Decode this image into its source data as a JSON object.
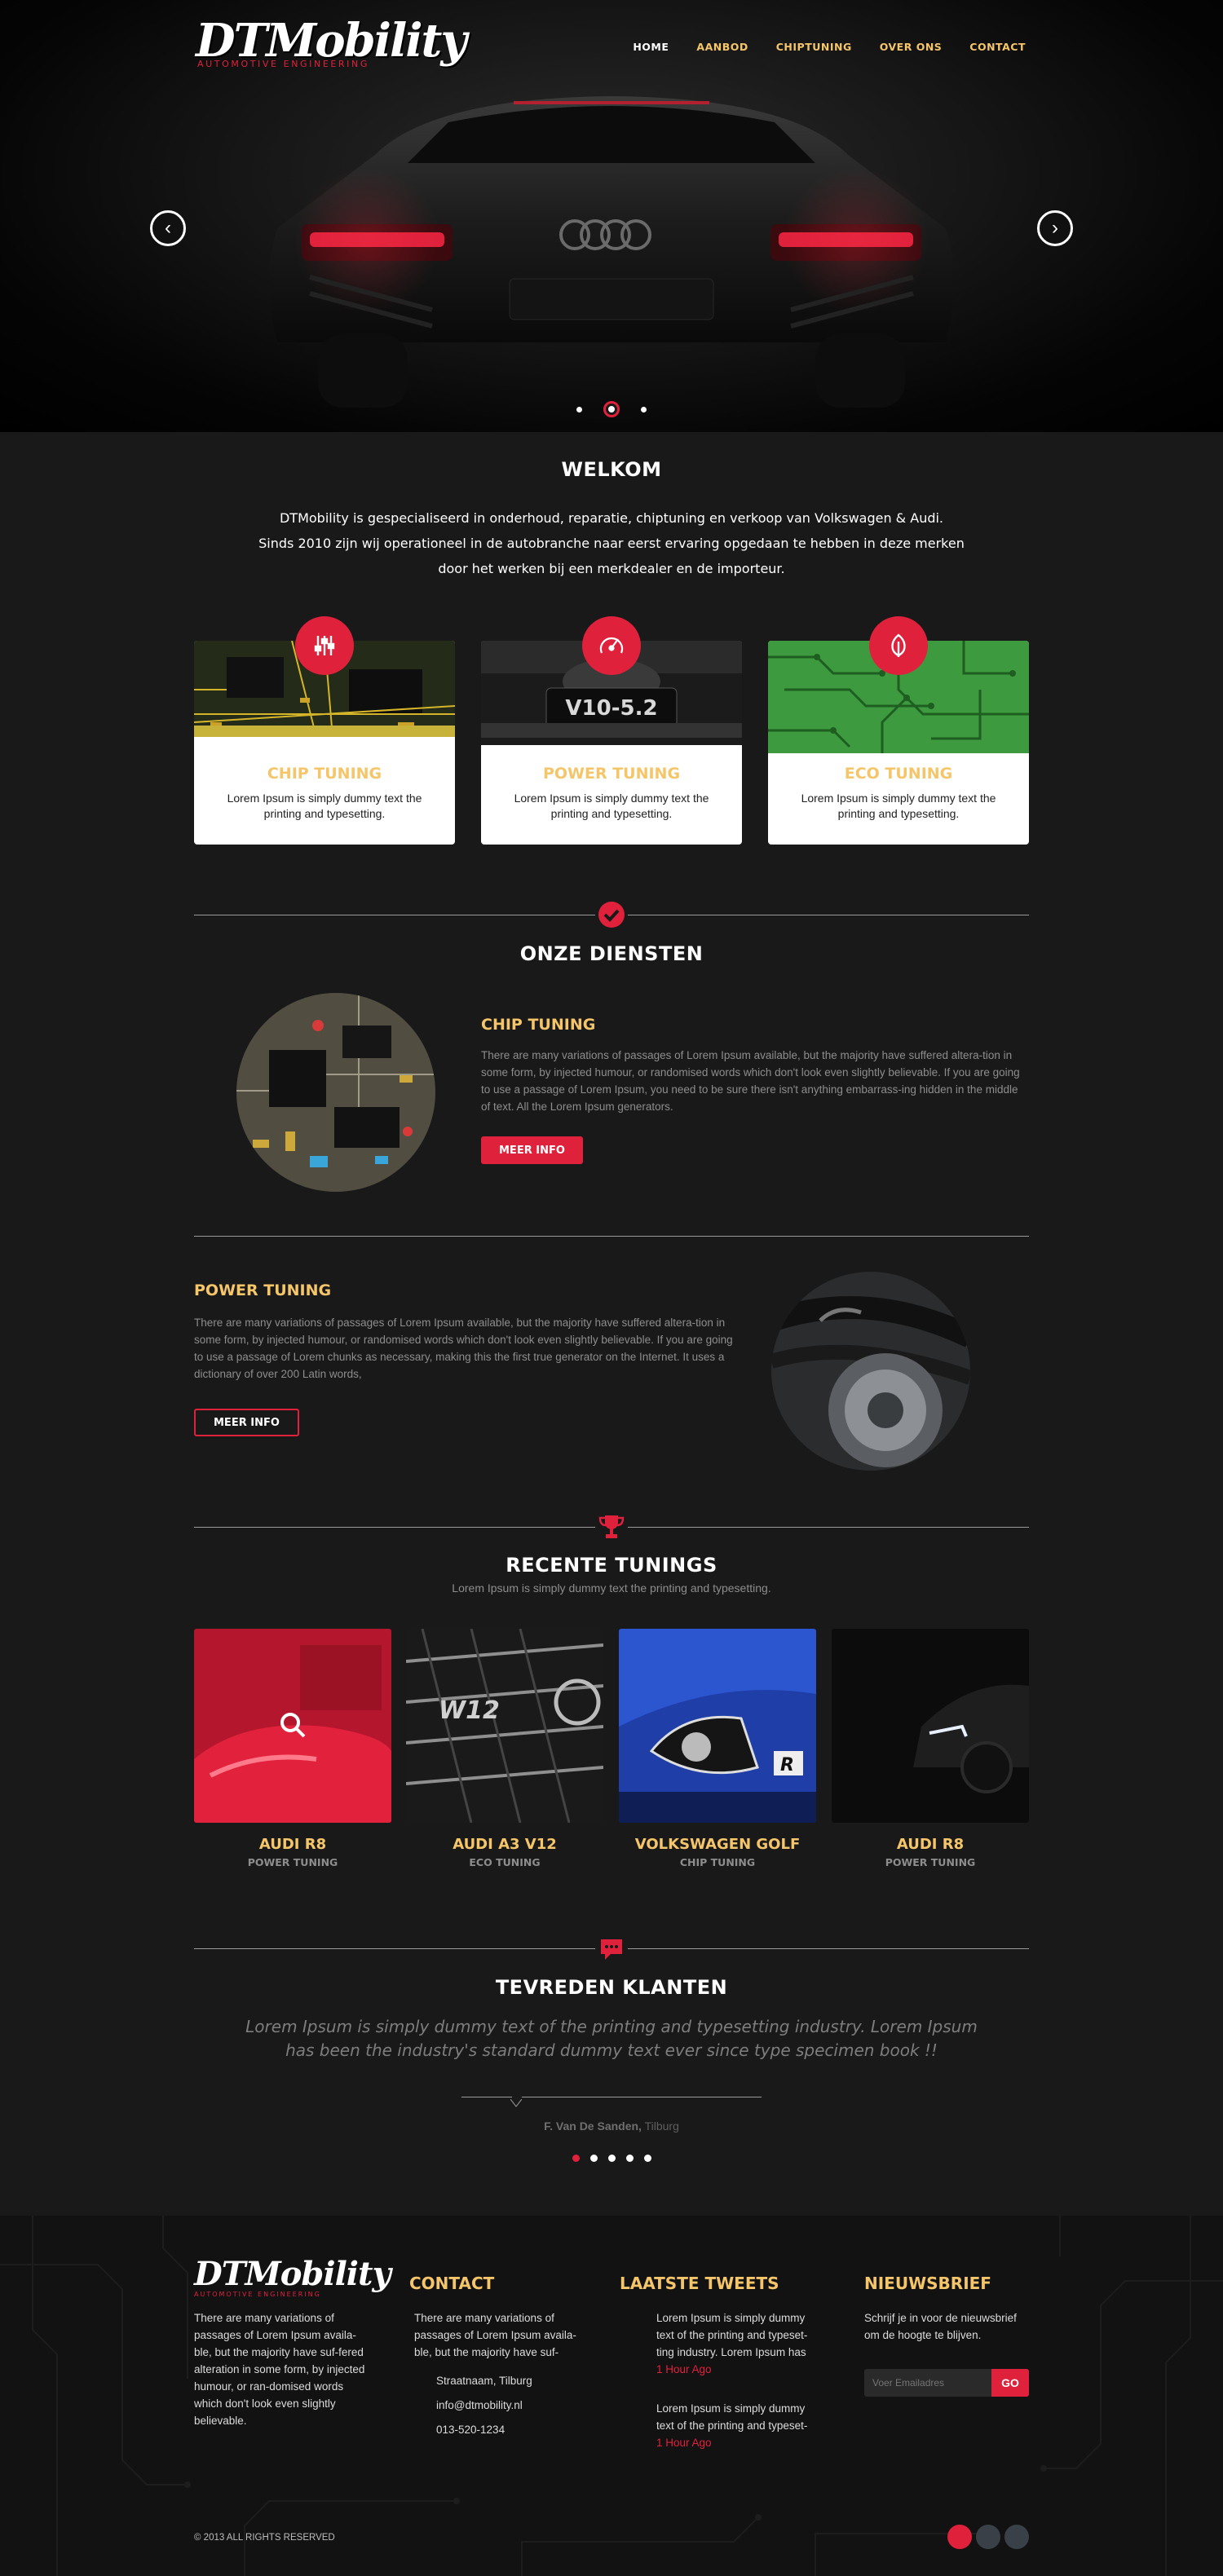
{
  "brand": {
    "name": "DTMobility",
    "tagline": "Automotive Engineering"
  },
  "nav": {
    "items": [
      "HOME",
      "AANBOD",
      "CHIPTUNING",
      "OVER ONS",
      "CONTACT"
    ],
    "active": "HOME"
  },
  "hero": {
    "prev_glyph": "‹",
    "next_glyph": "›",
    "slide_count": 3,
    "active_slide": 2
  },
  "welcome": {
    "title": "WELKOM",
    "lines": [
      "DTMobility is gespecialiseerd in onderhoud, reparatie, chiptuning en verkoop van Volkswagen & Audi.",
      "Sinds 2010 zijn wij operationeel in de autobranche naar eerst ervaring opgedaan te hebben in deze merken",
      "door het werken bij een merkdealer en de importeur."
    ]
  },
  "features": [
    {
      "title": "CHIP TUNING",
      "text": "Lorem Ipsum is simply dummy text the printing and typesetting.",
      "icon": "equalizer-icon"
    },
    {
      "title": "POWER TUNING",
      "text": "Lorem Ipsum is simply dummy text the printing and typesetting.",
      "icon": "speedometer-icon"
    },
    {
      "title": "ECO TUNING",
      "text": "Lorem Ipsum is simply dummy text the printing and typesetting.",
      "icon": "leaf-icon"
    }
  ],
  "services": {
    "title": "ONZE DIENSTEN",
    "icon": "check-circle-icon",
    "items": [
      {
        "title": "CHIP TUNING",
        "text": "There are many variations of passages of Lorem Ipsum available, but the majority have suffered altera-tion in some form, by injected humour, or randomised words which don't look even slightly believable. If you are going to use a passage of Lorem Ipsum, you need to be sure there isn't anything embarrass-ing hidden in the middle of text. All the Lorem Ipsum generators.",
        "button": "MEER INFO"
      },
      {
        "title": "POWER TUNING",
        "text": "There are many variations of passages of Lorem Ipsum available, but the majority have suffered altera-tion in some form, by injected humour, or randomised words which don't look even slightly believable. If you are going to use a passage of Lorem chunks as necessary, making this the first true generator on the Internet. It uses a dictionary of over 200 Latin words,",
        "button": "MEER INFO"
      }
    ]
  },
  "recent": {
    "title": "RECENTE TUNINGS",
    "subtitle": "Lorem Ipsum is simply dummy text the printing and typesetting.",
    "icon": "trophy-icon",
    "items": [
      {
        "name": "AUDI R8",
        "category": "POWER TUNING",
        "image_text": ""
      },
      {
        "name": "AUDI A3 V12",
        "category": "ECO TUNING",
        "image_text": "W12"
      },
      {
        "name": "VOLKSWAGEN GOLF",
        "category": "CHIP TUNING",
        "image_text": "R"
      },
      {
        "name": "AUDI R8",
        "category": "POWER TUNING",
        "image_text": ""
      }
    ]
  },
  "testimonials": {
    "title": "TEVREDEN KLANTEN",
    "icon": "chat-bubble-icon",
    "quote": "Lorem Ipsum is simply dummy text of the printing and typesetting industry. Lorem Ipsum has been the industry's standard dummy text ever since type specimen book !!",
    "author": "F. Van De Sanden,",
    "location": " Tilburg",
    "dot_count": 5,
    "active_dot": 1
  },
  "features_images": {
    "power_engine_text": "V10-5.2"
  },
  "footer": {
    "about": "There are many variations of passages of Lorem Ipsum availa-ble, but the majority have suf-fered alteration in some form, by injected humour, or ran-domised words which don't look even slightly believable.",
    "contact": {
      "title": "CONTACT",
      "text": "There are many variations of passages of Lorem Ipsum availa-ble, but the majority have suf-",
      "street": "Straatnaam, Tilburg",
      "email": "info@dtmobility.nl",
      "phone": "013-520-1234"
    },
    "tweets": {
      "title": "LAATSTE TWEETS",
      "items": [
        {
          "text": "Lorem Ipsum is simply dummy text of the printing and typeset-ting industry. Lorem Ipsum has",
          "time": "1 Hour Ago"
        },
        {
          "text": "Lorem Ipsum is simply dummy text of the printing and typeset-",
          "time": "1 Hour Ago"
        }
      ]
    },
    "newsletter": {
      "title": "NIEUWSBRIEF",
      "text": "Schrijf je in voor de nieuwsbrief om de hoogte te blijven.",
      "placeholder": "Voer Emailadres",
      "button": "GO"
    },
    "copyright": "© 2013 ALL RIGHTS RESERVED"
  },
  "colors": {
    "accent": "#e0213c",
    "gold": "#f5c56a",
    "background": "#191919"
  }
}
